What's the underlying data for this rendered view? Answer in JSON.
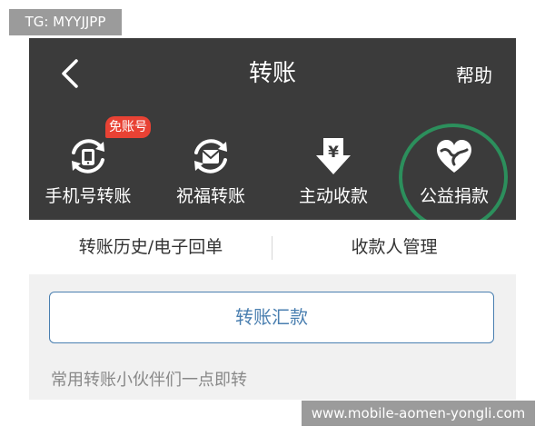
{
  "watermark_top": "TG: MYYJJPP",
  "watermark_bottom": "www.mobile-aomen-yongli.com",
  "header": {
    "title": "转账",
    "help_label": "帮助"
  },
  "actions": [
    {
      "label": "手机号转账",
      "icon": "phone-transfer-icon",
      "badge": "免账号"
    },
    {
      "label": "祝福转账",
      "icon": "blessing-transfer-icon"
    },
    {
      "label": "主动收款",
      "icon": "yuan-receive-icon"
    },
    {
      "label": "公益捐款",
      "icon": "heart-hands-icon"
    }
  ],
  "subnav": {
    "history_label": "转账历史/电子回单",
    "payee_label": "收款人管理"
  },
  "transfer_button_label": "转账汇款",
  "partners_hint": "常用转账小伙伴们一点即转",
  "colors": {
    "header_bg": "#3b3b3b",
    "badge_red": "#e84234",
    "highlight_green": "#2c8f5c",
    "button_blue": "#4a7fb0"
  }
}
